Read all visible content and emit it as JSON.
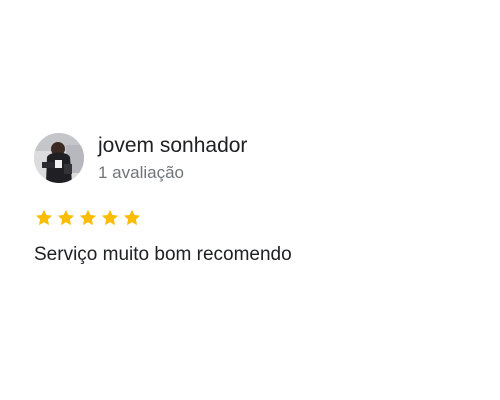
{
  "review": {
    "author_name": "jovem sonhador",
    "review_count": "1 avaliação",
    "rating": 5,
    "rating_max": 5,
    "text": "Serviço muito bom recomendo"
  },
  "colors": {
    "star": "#fbbc04",
    "name": "#202124",
    "meta": "#70757a"
  },
  "icons": {
    "avatar": "profile-photo",
    "star": "star-icon"
  }
}
